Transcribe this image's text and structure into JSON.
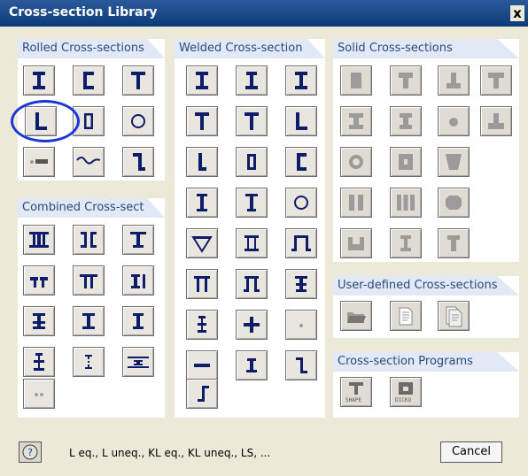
{
  "title": "Cross-section Library",
  "close_glyph": "x",
  "panels": {
    "rolled": "Rolled Cross-sections",
    "welded": "Welded Cross-section",
    "solid": "Solid Cross-sections",
    "combined": "Combined Cross-sect",
    "user_defined": "User-defined Cross-sections",
    "programs": "Cross-section Programs"
  },
  "programs_labels": {
    "shape": "SHAPE",
    "dicko": "DICKO"
  },
  "status_text": "L eq., L uneq., KL eq., KL uneq., LS, ...",
  "cancel_label": "Cancel",
  "colors": {
    "selection_circle": "#1b37d6",
    "section_fill": "#0d1d6a"
  }
}
